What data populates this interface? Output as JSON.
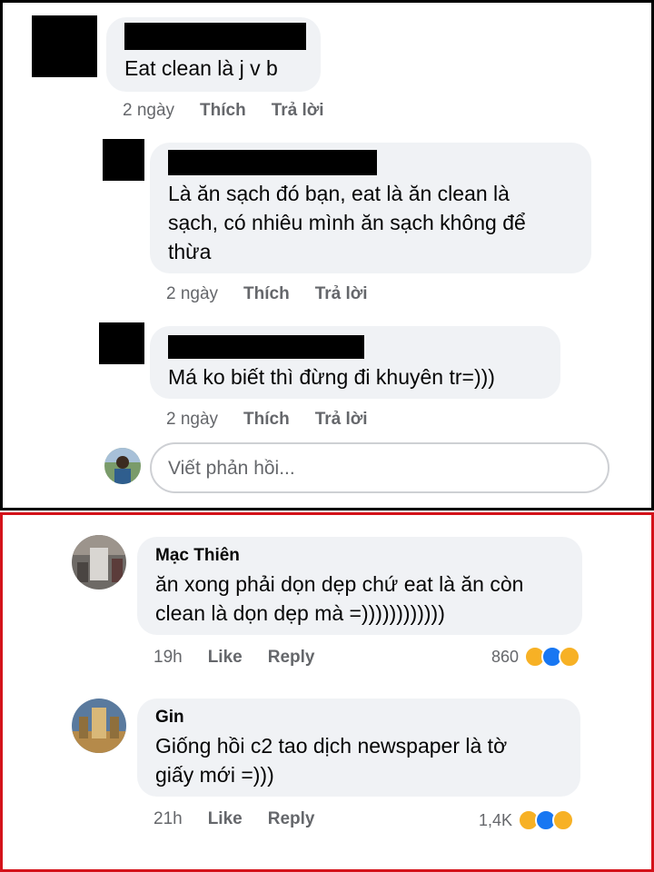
{
  "top_thread": {
    "comment": {
      "text": "Eat clean là j v b",
      "time": "2 ngày",
      "like_label": "Thích",
      "reply_label": "Trả lời"
    },
    "reply_1": {
      "text_line1": "Là ăn sạch đó bạn, eat là ăn clean là",
      "text_line2": "sạch, có nhiêu mình ăn sạch không để",
      "text_line3": "thừa",
      "time": "2 ngày",
      "like_label": "Thích",
      "reply_label": "Trả lời"
    },
    "reply_2": {
      "text": "Má ko biết thì đừng đi khuyên tr=)))",
      "time": "2 ngày",
      "like_label": "Thích",
      "reply_label": "Trả lời"
    },
    "reply_input": {
      "placeholder": "Viết phản hồi..."
    }
  },
  "bottom_thread": {
    "comment_1": {
      "name": "Mạc Thiên",
      "text_line1": "ăn xong phải dọn dẹp chứ eat là ăn còn",
      "text_line2": "clean là dọn dẹp mà =))))))))))))",
      "time": "19h",
      "like_label": "Like",
      "reply_label": "Reply",
      "reaction_count": "860"
    },
    "comment_2": {
      "name": "Gin",
      "text_line1": "Giống hồi c2 tao dịch newspaper là tờ",
      "text_line2": "giấy mới =)))",
      "time": "21h",
      "like_label": "Like",
      "reply_label": "Reply",
      "reaction_count": "1,4K"
    }
  },
  "colors": {
    "bubble_bg": "#f0f2f5",
    "meta_text": "#65676b",
    "top_border": "#000000",
    "bottom_border": "#d4121a",
    "like_blue": "#1877f2",
    "emoji_yellow": "#f7b125"
  },
  "icons": [
    "haha-reaction-icon",
    "like-reaction-icon",
    "sad-reaction-icon"
  ]
}
